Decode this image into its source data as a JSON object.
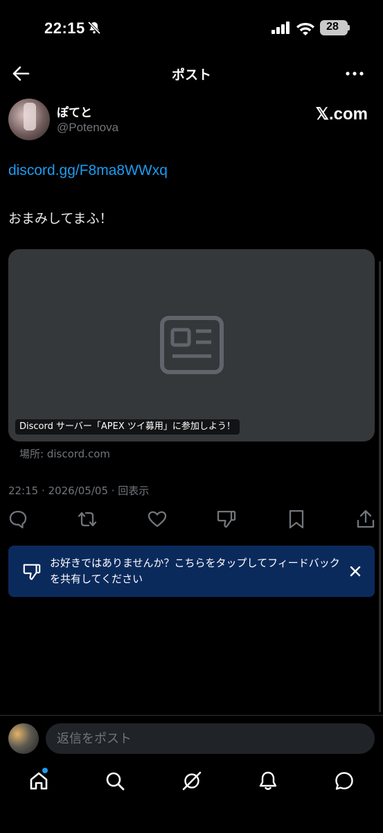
{
  "status": {
    "time": "22:15",
    "battery": "28"
  },
  "header": {
    "title": "ポスト"
  },
  "author": {
    "display_name": "ぽてと",
    "handle": "@Potenova",
    "platform": "𝕏.com"
  },
  "post": {
    "link": "discord.gg/F8ma8WWxq",
    "text": "おまみしてまふ！",
    "card_caption": "Discord サーバー「APEX ツイ募用」に参加しよう！",
    "card_domain": "場所: discord.com",
    "meta": "22:15 · 2026/05/05 · 回表示"
  },
  "toast": {
    "text": "お好きではありませんか？こちらをタップしてフィードバックを共有してください"
  },
  "reply": {
    "placeholder": "返信をポスト"
  },
  "colors": {
    "accent": "#1d9bf0",
    "toast_bg": "#0b2a5c",
    "card_bg": "#35383b"
  },
  "tabs": [
    "home-icon",
    "search-icon",
    "grok-icon",
    "bell-icon",
    "chat-icon"
  ]
}
